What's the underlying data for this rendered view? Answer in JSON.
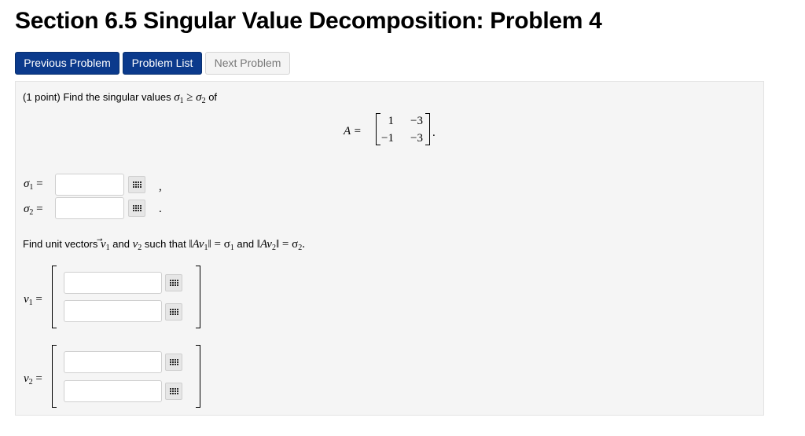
{
  "page": {
    "title": "Section 6.5 Singular Value Decomposition: Problem 4"
  },
  "nav": {
    "previous": "Previous Problem",
    "list": "Problem List",
    "next": "Next Problem"
  },
  "problem": {
    "points": "(1 point)",
    "prompt": "Find the singular values",
    "sigma1": "σ",
    "sub1": "1",
    "geq": "≥",
    "sigma2": "σ",
    "sub2": "2",
    "of": "of",
    "matrix_label": "A =",
    "matrix": [
      [
        "1",
        "−3"
      ],
      [
        "−1",
        "−3"
      ]
    ],
    "matrix_end": ".",
    "sigma1_label": "σ",
    "sigma2_label": "σ",
    "eq": "=",
    "sep1": ",",
    "sep2": ".",
    "part2_prompt_a": "Find unit vectors",
    "v1": "v",
    "v2": "v",
    "and": "and",
    "such_that": "such that",
    "norm_expr1": "‖Av",
    "norm_expr2": "‖ = σ",
    "period": ".",
    "v1_label": "v",
    "v2_label": "v",
    "answers": {
      "sigma1": "",
      "sigma2": "",
      "v1_1": "",
      "v1_2": "",
      "v2_1": "",
      "v2_2": ""
    }
  }
}
